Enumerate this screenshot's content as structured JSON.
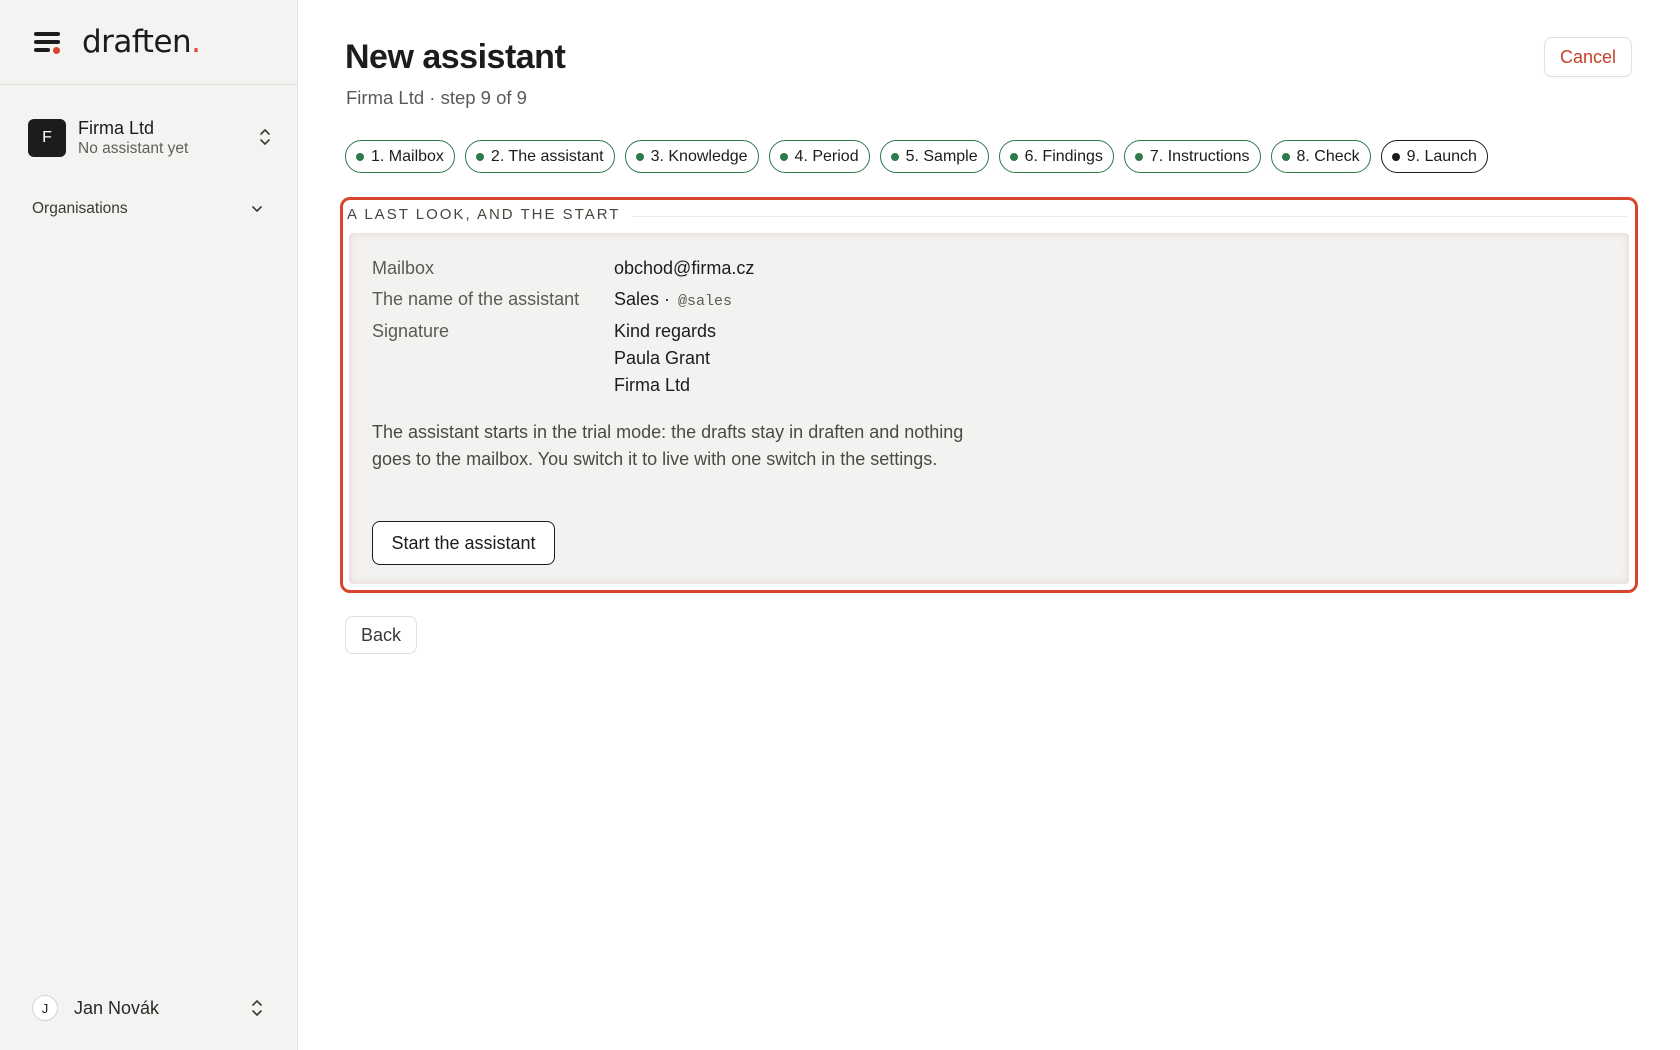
{
  "brand": {
    "logo_text": "draften",
    "logo_dot": ".",
    "accent": "#d8452e"
  },
  "sidebar": {
    "org": {
      "initial": "F",
      "name": "Firma Ltd",
      "subtitle": "No assistant yet"
    },
    "organisations_label": "Organisations",
    "user": {
      "initial": "J",
      "name": "Jan Novák"
    }
  },
  "header": {
    "title": "New assistant",
    "subtitle": "Firma Ltd · step 9 of 9",
    "cancel_label": "Cancel"
  },
  "steps": [
    {
      "label": "1. Mailbox",
      "done": true
    },
    {
      "label": "2. The assistant",
      "done": true
    },
    {
      "label": "3. Knowledge",
      "done": true
    },
    {
      "label": "4. Period",
      "done": true
    },
    {
      "label": "5. Sample",
      "done": true
    },
    {
      "label": "6. Findings",
      "done": true
    },
    {
      "label": "7. Instructions",
      "done": true
    },
    {
      "label": "8. Check",
      "done": true
    },
    {
      "label": "9. Launch",
      "current": true
    }
  ],
  "review": {
    "heading": "A LAST LOOK, AND THE START",
    "mailbox_label": "Mailbox",
    "mailbox_value": "obchod@firma.cz",
    "name_label": "The name of the assistant",
    "name_value": "Sales ·",
    "name_handle": "@sales",
    "signature_label": "Signature",
    "signature_lines": [
      "Kind regards",
      "Paula Grant",
      "Firma Ltd"
    ],
    "note": "The assistant starts in the trial mode: the drafts stay in draften and nothing goes to the mailbox. You switch it to live with one switch in the settings.",
    "start_label": "Start the assistant"
  },
  "back_label": "Back",
  "colors": {
    "step_done": "#2f7a4c",
    "highlight": "#d8452e",
    "sidebar_bg": "#f4f3f1"
  }
}
